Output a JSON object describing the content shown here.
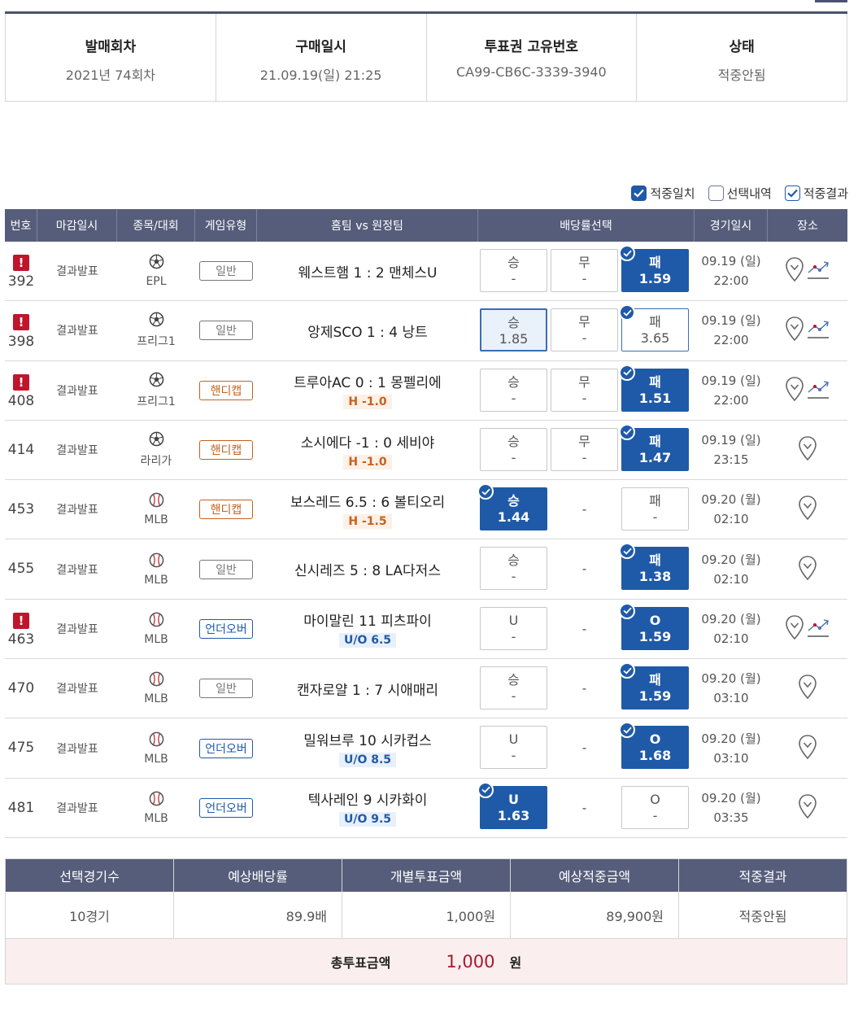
{
  "ticket_info": [
    {
      "label": "발매회차",
      "value": "2021년 74회차"
    },
    {
      "label": "구매일시",
      "value": "21.09.19(일) 21:25"
    },
    {
      "label": "투표권 고유번호",
      "value": "CA99-CB6C-3339-3940"
    },
    {
      "label": "상태",
      "value": "적중안됨"
    }
  ],
  "legend": [
    {
      "label": "적중일치",
      "state": "checked"
    },
    {
      "label": "선택내역",
      "state": "empty"
    },
    {
      "label": "적중결과",
      "state": "outline-check"
    }
  ],
  "columns": [
    "번호",
    "마감일시",
    "종목/대회",
    "게임유형",
    "홈팀 vs 원정팀",
    "배당률선택",
    "경기일시",
    "장소"
  ],
  "games": [
    {
      "no": "392",
      "warn": true,
      "deadline": "결과발표",
      "sport": "soccer-ball-icon",
      "league": "EPL",
      "type": "일반",
      "type_style": "g",
      "match": "웨스트햄 1 : 2 맨체스U",
      "sub": "",
      "odds": [
        {
          "label": "승",
          "value": "-"
        },
        {
          "label": "무",
          "value": "-"
        },
        {
          "label": "패",
          "value": "1.59",
          "state": "result"
        }
      ],
      "date": "09.19 (일)",
      "time": "22:00",
      "chart": true
    },
    {
      "no": "398",
      "warn": true,
      "deadline": "결과발표",
      "sport": "soccer-ball-icon",
      "league": "프리그1",
      "type": "일반",
      "type_style": "g",
      "match": "앙제SCO 1 : 4 낭트",
      "sub": "",
      "odds": [
        {
          "label": "승",
          "value": "1.85",
          "state": "picked"
        },
        {
          "label": "무",
          "value": "-"
        },
        {
          "label": "패",
          "value": "3.65",
          "state": "result-outline"
        }
      ],
      "date": "09.19 (일)",
      "time": "22:00",
      "chart": true
    },
    {
      "no": "408",
      "warn": true,
      "deadline": "결과발표",
      "sport": "soccer-ball-icon",
      "league": "프리그1",
      "type": "핸디캡",
      "type_style": "h",
      "match": "트루아AC 0 : 1 몽펠리에",
      "sub": "H -1.0",
      "sub_style": "h",
      "odds": [
        {
          "label": "승",
          "value": "-"
        },
        {
          "label": "무",
          "value": "-"
        },
        {
          "label": "패",
          "value": "1.51",
          "state": "result"
        }
      ],
      "date": "09.19 (일)",
      "time": "22:00",
      "chart": true
    },
    {
      "no": "414",
      "warn": false,
      "deadline": "결과발표",
      "sport": "soccer-ball-icon",
      "league": "라리가",
      "type": "핸디캡",
      "type_style": "h",
      "match": "소시에다 -1 : 0 세비야",
      "sub": "H -1.0",
      "sub_style": "h",
      "odds": [
        {
          "label": "승",
          "value": "-"
        },
        {
          "label": "무",
          "value": "-"
        },
        {
          "label": "패",
          "value": "1.47",
          "state": "result"
        }
      ],
      "date": "09.19 (일)",
      "time": "23:15",
      "chart": false
    },
    {
      "no": "453",
      "warn": false,
      "deadline": "결과발표",
      "sport": "baseball-icon",
      "league": "MLB",
      "type": "핸디캡",
      "type_style": "h",
      "match": "보스레드 6.5 : 6 볼티오리",
      "sub": "H -1.5",
      "sub_style": "h",
      "odds": [
        {
          "label": "승",
          "value": "1.44",
          "state": "result"
        },
        {
          "label": "",
          "value": "-",
          "state": "dash"
        },
        {
          "label": "패",
          "value": "-"
        }
      ],
      "date": "09.20 (월)",
      "time": "02:10",
      "chart": false
    },
    {
      "no": "455",
      "warn": false,
      "deadline": "결과발표",
      "sport": "baseball-icon",
      "league": "MLB",
      "type": "일반",
      "type_style": "g",
      "match": "신시레즈 5 : 8 LA다저스",
      "sub": "",
      "odds": [
        {
          "label": "승",
          "value": "-"
        },
        {
          "label": "",
          "value": "-",
          "state": "dash"
        },
        {
          "label": "패",
          "value": "1.38",
          "state": "result"
        }
      ],
      "date": "09.20 (월)",
      "time": "02:10",
      "chart": false
    },
    {
      "no": "463",
      "warn": true,
      "deadline": "결과발표",
      "sport": "baseball-icon",
      "league": "MLB",
      "type": "언더오버",
      "type_style": "u",
      "match": "마이말린   11   피츠파이",
      "sub": "U/O 6.5",
      "sub_style": "u",
      "odds": [
        {
          "label": "U",
          "value": "-"
        },
        {
          "label": "",
          "value": "-",
          "state": "dash"
        },
        {
          "label": "O",
          "value": "1.59",
          "state": "result"
        }
      ],
      "date": "09.20 (월)",
      "time": "02:10",
      "chart": true
    },
    {
      "no": "470",
      "warn": false,
      "deadline": "결과발표",
      "sport": "baseball-icon",
      "league": "MLB",
      "type": "일반",
      "type_style": "g",
      "match": "캔자로얄 1 : 7 시애매리",
      "sub": "",
      "odds": [
        {
          "label": "승",
          "value": "-"
        },
        {
          "label": "",
          "value": "-",
          "state": "dash"
        },
        {
          "label": "패",
          "value": "1.59",
          "state": "result"
        }
      ],
      "date": "09.20 (월)",
      "time": "03:10",
      "chart": false
    },
    {
      "no": "475",
      "warn": false,
      "deadline": "결과발표",
      "sport": "baseball-icon",
      "league": "MLB",
      "type": "언더오버",
      "type_style": "u",
      "match": "밀워브루   10   시카컵스",
      "sub": "U/O 8.5",
      "sub_style": "u",
      "odds": [
        {
          "label": "U",
          "value": "-"
        },
        {
          "label": "",
          "value": "-",
          "state": "dash"
        },
        {
          "label": "O",
          "value": "1.68",
          "state": "result"
        }
      ],
      "date": "09.20 (월)",
      "time": "03:10",
      "chart": false
    },
    {
      "no": "481",
      "warn": false,
      "deadline": "결과발표",
      "sport": "baseball-icon",
      "league": "MLB",
      "type": "언더오버",
      "type_style": "u",
      "match": "텍사레인   9   시카화이",
      "sub": "U/O 9.5",
      "sub_style": "u",
      "odds": [
        {
          "label": "U",
          "value": "1.63",
          "state": "result"
        },
        {
          "label": "",
          "value": "-",
          "state": "dash"
        },
        {
          "label": "O",
          "value": "-"
        }
      ],
      "date": "09.20 (월)",
      "time": "03:35",
      "chart": false
    }
  ],
  "summary": {
    "headers": [
      "선택경기수",
      "예상배당률",
      "개별투표금액",
      "예상적중금액",
      "적중결과"
    ],
    "values": [
      "10경기",
      "89.9배",
      "1,000원",
      "89,900원",
      "적중안됨"
    ],
    "total_label": "총투표금액",
    "total_amount": "1,000",
    "total_unit": "원"
  },
  "colors": {
    "header": "#555d7a",
    "selected": "#1f5aa8",
    "warn": "#c0152b",
    "handicap": "#c4621f",
    "total": "#a6192e"
  }
}
